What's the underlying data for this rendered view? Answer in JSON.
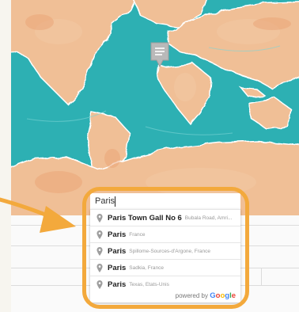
{
  "search": {
    "value": "Paris"
  },
  "suggestions": [
    {
      "main": "Paris Town Gall No 6",
      "secondary": "Bubala Road, Amri..."
    },
    {
      "main": "Paris",
      "secondary": "France"
    },
    {
      "main": "Paris",
      "secondary": "Spillome-Sources-d'Argone, France"
    },
    {
      "main": "Paris",
      "secondary": "Sadkia, France"
    },
    {
      "main": "Paris",
      "secondary": "Texas, Etats-Unis"
    }
  ],
  "attribution": {
    "prefix": "powered by",
    "brand": "Google"
  },
  "colors": {
    "ocean": "#26a9ad",
    "land": "#f0bf96",
    "frame": "#f3a93c",
    "arrow": "#f3a93c",
    "pin": "#b9b9b9",
    "google_blue": "#4285f4",
    "google_red": "#ea4335",
    "google_yellow": "#fbbc05",
    "google_green": "#34a853"
  },
  "icons": {
    "map_pin": "map-marker-icon",
    "suggestion_pin": "location-pin-icon"
  }
}
